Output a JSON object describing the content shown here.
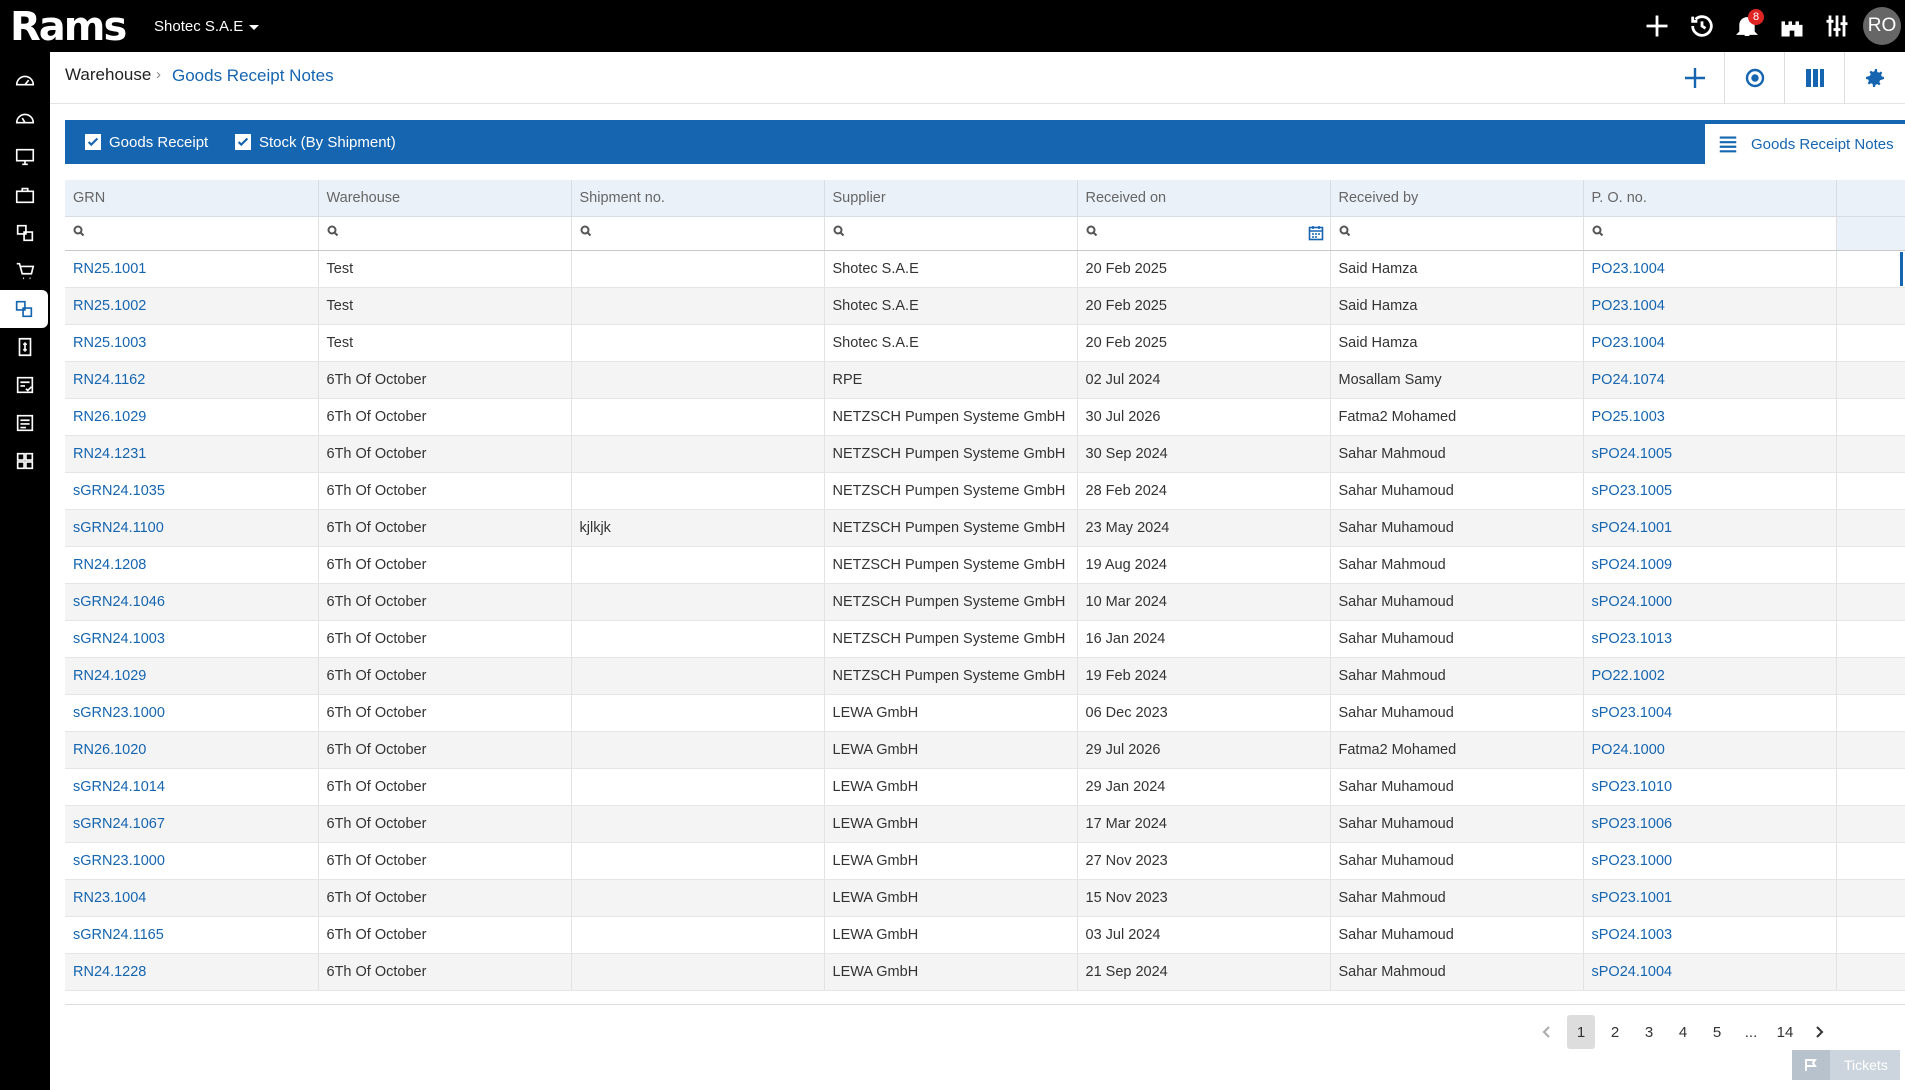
{
  "app": {
    "logo_text": "Rams",
    "company": "Shotec S.A.E",
    "avatar_initials": "RO",
    "notifications_count": "8"
  },
  "breadcrumb": {
    "section": "Warehouse",
    "page": "Goods Receipt Notes"
  },
  "tabs": [
    {
      "label": "Goods Receipt",
      "checked": true
    },
    {
      "label": "Stock (By Shipment)",
      "checked": true
    }
  ],
  "active_view": "Goods Receipt Notes",
  "columns": [
    "GRN",
    "Warehouse",
    "Shipment no.",
    "Supplier",
    "Received on",
    "Received by",
    "P. O. no."
  ],
  "rows": [
    [
      "RN25.1001",
      "Test",
      "",
      "Shotec S.A.E",
      "20 Feb 2025",
      "Said Hamza",
      "PO23.1004"
    ],
    [
      "RN25.1002",
      "Test",
      "",
      "Shotec S.A.E",
      "20 Feb 2025",
      "Said Hamza",
      "PO23.1004"
    ],
    [
      "RN25.1003",
      "Test",
      "",
      "Shotec S.A.E",
      "20 Feb 2025",
      "Said Hamza",
      "PO23.1004"
    ],
    [
      "RN24.1162",
      "6Th Of October",
      "",
      "RPE",
      "02 Jul 2024",
      "Mosallam Samy",
      "PO24.1074"
    ],
    [
      "RN26.1029",
      "6Th Of October",
      "",
      "NETZSCH Pumpen Systeme GmbH",
      "30 Jul 2026",
      "Fatma2 Mohamed",
      "PO25.1003"
    ],
    [
      "RN24.1231",
      "6Th Of October",
      "",
      "NETZSCH Pumpen Systeme GmbH",
      "30 Sep 2024",
      "Sahar Mahmoud",
      "sPO24.1005"
    ],
    [
      "sGRN24.1035",
      "6Th Of October",
      "",
      "NETZSCH Pumpen Systeme GmbH",
      "28 Feb 2024",
      "Sahar Muhamoud",
      "sPO23.1005"
    ],
    [
      "sGRN24.1100",
      "6Th Of October",
      "kjlkjk",
      "NETZSCH Pumpen Systeme GmbH",
      "23 May 2024",
      "Sahar Muhamoud",
      "sPO24.1001"
    ],
    [
      "RN24.1208",
      "6Th Of October",
      "",
      "NETZSCH Pumpen Systeme GmbH",
      "19 Aug 2024",
      "Sahar Mahmoud",
      "sPO24.1009"
    ],
    [
      "sGRN24.1046",
      "6Th Of October",
      "",
      "NETZSCH Pumpen Systeme GmbH",
      "10 Mar 2024",
      "Sahar Muhamoud",
      "sPO24.1000"
    ],
    [
      "sGRN24.1003",
      "6Th Of October",
      "",
      "NETZSCH Pumpen Systeme GmbH",
      "16 Jan 2024",
      "Sahar Muhamoud",
      "sPO23.1013"
    ],
    [
      "RN24.1029",
      "6Th Of October",
      "",
      "NETZSCH Pumpen Systeme GmbH",
      "19 Feb 2024",
      "Sahar Mahmoud",
      "PO22.1002"
    ],
    [
      "sGRN23.1000",
      "6Th Of October",
      "",
      "LEWA GmbH",
      "06 Dec 2023",
      "Sahar Muhamoud",
      "sPO23.1004"
    ],
    [
      "RN26.1020",
      "6Th Of October",
      "",
      "LEWA GmbH",
      "29 Jul 2026",
      "Fatma2 Mohamed",
      "PO24.1000"
    ],
    [
      "sGRN24.1014",
      "6Th Of October",
      "",
      "LEWA GmbH",
      "29 Jan 2024",
      "Sahar Muhamoud",
      "sPO23.1010"
    ],
    [
      "sGRN24.1067",
      "6Th Of October",
      "",
      "LEWA GmbH",
      "17 Mar 2024",
      "Sahar Muhamoud",
      "sPO23.1006"
    ],
    [
      "sGRN23.1000",
      "6Th Of October",
      "",
      "LEWA GmbH",
      "27 Nov 2023",
      "Sahar Muhamoud",
      "sPO23.1000"
    ],
    [
      "RN23.1004",
      "6Th Of October",
      "",
      "LEWA GmbH",
      "15 Nov 2023",
      "Sahar Mahmoud",
      "sPO23.1001"
    ],
    [
      "sGRN24.1165",
      "6Th Of October",
      "",
      "LEWA GmbH",
      "03 Jul 2024",
      "Sahar Muhamoud",
      "sPO24.1003"
    ],
    [
      "RN24.1228",
      "6Th Of October",
      "",
      "LEWA GmbH",
      "21 Sep 2024",
      "Sahar Mahmoud",
      "sPO24.1004"
    ]
  ],
  "pagination": {
    "pages": [
      "1",
      "2",
      "3",
      "4",
      "5"
    ],
    "ellipsis": "...",
    "last": "14",
    "current": "1"
  },
  "tickets_label": "Tickets",
  "colors": {
    "accent": "#1565b0",
    "topbar": "#000000",
    "header_bg": "#eaf1f8"
  }
}
